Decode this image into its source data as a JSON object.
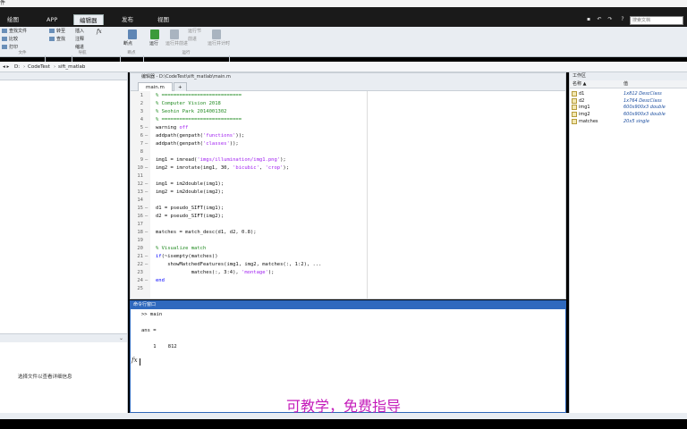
{
  "app": {
    "title_char": "件"
  },
  "tabs": [
    {
      "label": "绘图",
      "active": false
    },
    {
      "label": "APP",
      "active": false
    },
    {
      "label": "编辑器",
      "active": true
    },
    {
      "label": "发布",
      "active": false
    },
    {
      "label": "视图",
      "active": false
    }
  ],
  "search": {
    "placeholder": "搜索文档"
  },
  "ribbon": {
    "find_files": "查找文件",
    "compare": "比较",
    "print": "打印",
    "insert": "插入",
    "fx": "fx",
    "comment": "注释",
    "indent": "缩进",
    "goto": "转至",
    "find": "查找",
    "breakpoints": "断点",
    "run": "运行",
    "run_advance": "运行并前进",
    "run_section": "运行节",
    "advance": "前进",
    "run_time": "运行并计时",
    "sections": [
      "文件",
      "导航",
      "断点",
      "运行"
    ]
  },
  "address": {
    "drive": "D:",
    "folders": [
      "CodeTest",
      "sift_matlab"
    ]
  },
  "left_pane": {
    "detail_text": "选择文件以查看详细信息"
  },
  "editor": {
    "title": "编辑器 - D:\\CodeTest\\sift_matlab\\main.m",
    "active_tab": "main.m",
    "plus": "+",
    "lines": [
      {
        "n": "1",
        "dash": "",
        "parts": [
          {
            "t": "% ===========================",
            "c": "comment"
          }
        ]
      },
      {
        "n": "2",
        "dash": "",
        "parts": [
          {
            "t": "% Computer Vision 2018",
            "c": "comment"
          }
        ]
      },
      {
        "n": "3",
        "dash": "",
        "parts": [
          {
            "t": "% Seohin Park 2014001302",
            "c": "comment"
          }
        ]
      },
      {
        "n": "4",
        "dash": "",
        "parts": [
          {
            "t": "% ===========================",
            "c": "comment"
          }
        ]
      },
      {
        "n": "5",
        "dash": "—",
        "parts": [
          {
            "t": "warning ",
            "c": "plain"
          },
          {
            "t": "off",
            "c": "str"
          }
        ]
      },
      {
        "n": "6",
        "dash": "—",
        "parts": [
          {
            "t": "addpath(genpath(",
            "c": "plain"
          },
          {
            "t": "'functions'",
            "c": "str"
          },
          {
            "t": "));",
            "c": "plain"
          }
        ]
      },
      {
        "n": "7",
        "dash": "—",
        "parts": [
          {
            "t": "addpath(genpath(",
            "c": "plain"
          },
          {
            "t": "'classes'",
            "c": "str"
          },
          {
            "t": "));",
            "c": "plain"
          }
        ]
      },
      {
        "n": "8",
        "dash": "",
        "parts": []
      },
      {
        "n": "9",
        "dash": "—",
        "parts": [
          {
            "t": "img1 = imread(",
            "c": "plain"
          },
          {
            "t": "'imgs/illumination/img1.png'",
            "c": "str"
          },
          {
            "t": ");",
            "c": "plain"
          }
        ]
      },
      {
        "n": "10",
        "dash": "—",
        "parts": [
          {
            "t": "img2 = imrotate(img1, 30, ",
            "c": "plain"
          },
          {
            "t": "'bicubic'",
            "c": "str"
          },
          {
            "t": ", ",
            "c": "plain"
          },
          {
            "t": "'crop'",
            "c": "str"
          },
          {
            "t": ");",
            "c": "plain"
          }
        ]
      },
      {
        "n": "11",
        "dash": "",
        "parts": []
      },
      {
        "n": "12",
        "dash": "—",
        "parts": [
          {
            "t": "img1 = im2double(img1);",
            "c": "plain"
          }
        ]
      },
      {
        "n": "13",
        "dash": "—",
        "parts": [
          {
            "t": "img2 = im2double(img2);",
            "c": "plain"
          }
        ]
      },
      {
        "n": "14",
        "dash": "",
        "parts": []
      },
      {
        "n": "15",
        "dash": "—",
        "parts": [
          {
            "t": "d1 = pseudo_SIFT(img1);",
            "c": "plain"
          }
        ]
      },
      {
        "n": "16",
        "dash": "—",
        "parts": [
          {
            "t": "d2 = pseudo_SIFT(img2);",
            "c": "plain"
          }
        ]
      },
      {
        "n": "17",
        "dash": "",
        "parts": []
      },
      {
        "n": "18",
        "dash": "—",
        "parts": [
          {
            "t": "matches = match_desc(d1, d2, 0.8);",
            "c": "plain"
          }
        ]
      },
      {
        "n": "19",
        "dash": "",
        "parts": []
      },
      {
        "n": "20",
        "dash": "",
        "parts": [
          {
            "t": "% Visualize match",
            "c": "comment"
          }
        ]
      },
      {
        "n": "21",
        "dash": "—",
        "parts": [
          {
            "t": "if",
            "c": "kw"
          },
          {
            "t": "(~isempty(matches))",
            "c": "plain"
          }
        ]
      },
      {
        "n": "22",
        "dash": "—",
        "parts": [
          {
            "t": "    showMatchedFeatures(img1, img2, matches(:, 1:2), ...",
            "c": "plain"
          }
        ]
      },
      {
        "n": "23",
        "dash": "",
        "parts": [
          {
            "t": "            matches(:, 3:4), ",
            "c": "plain"
          },
          {
            "t": "'montage'",
            "c": "str"
          },
          {
            "t": ");",
            "c": "plain"
          }
        ]
      },
      {
        "n": "24",
        "dash": "—",
        "parts": [
          {
            "t": "end",
            "c": "kw"
          }
        ]
      },
      {
        "n": "25",
        "dash": "",
        "parts": []
      }
    ]
  },
  "command_window": {
    "title": "命令行窗口",
    "lines": [
      ">> main",
      "",
      "ans =",
      "",
      "    1    812"
    ],
    "prompt_icon": "fx"
  },
  "workspace": {
    "title": "工作区",
    "col_name": "名称 ▲",
    "col_value": "值",
    "vars": [
      {
        "name": "d1",
        "value": "1x812 DescClass"
      },
      {
        "name": "d2",
        "value": "1x764 DescClass"
      },
      {
        "name": "img1",
        "value": "600x900x3 double"
      },
      {
        "name": "img2",
        "value": "600x900x3 double"
      },
      {
        "name": "matches",
        "value": "20x5 single"
      }
    ]
  },
  "overlay": {
    "subtitle": "可教学，免费指导"
  }
}
